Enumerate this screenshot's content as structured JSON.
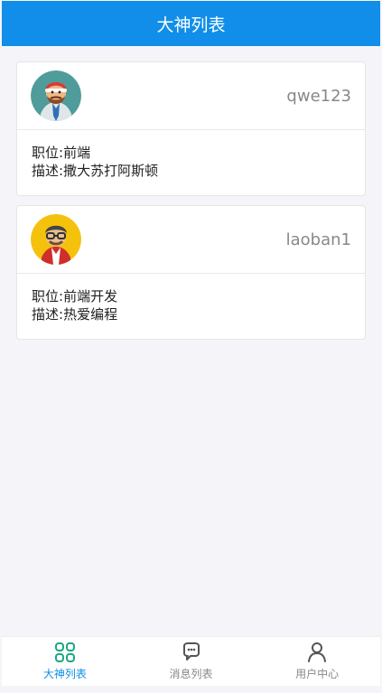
{
  "header": {
    "title": "大神列表"
  },
  "users": [
    {
      "username": "qwe123",
      "position_label": "职位:",
      "position": "前端",
      "description_label": "描述:",
      "description": "撒大苏打阿斯顿"
    },
    {
      "username": "laoban1",
      "position_label": "职位:",
      "position": "前端开发",
      "description_label": "描述:",
      "description": "热爱编程"
    }
  ],
  "tabbar": {
    "items": [
      {
        "label": "大神列表",
        "icon": "grid-icon",
        "active": true
      },
      {
        "label": "消息列表",
        "icon": "chat-bubble-icon",
        "active": false
      },
      {
        "label": "用户中心",
        "icon": "user-icon",
        "active": false
      }
    ]
  },
  "colors": {
    "header_bg": "#108ee9",
    "active_tab": "#108ee9",
    "tab_icon_active": "#1aa884",
    "page_bg": "#f5f5f9"
  }
}
